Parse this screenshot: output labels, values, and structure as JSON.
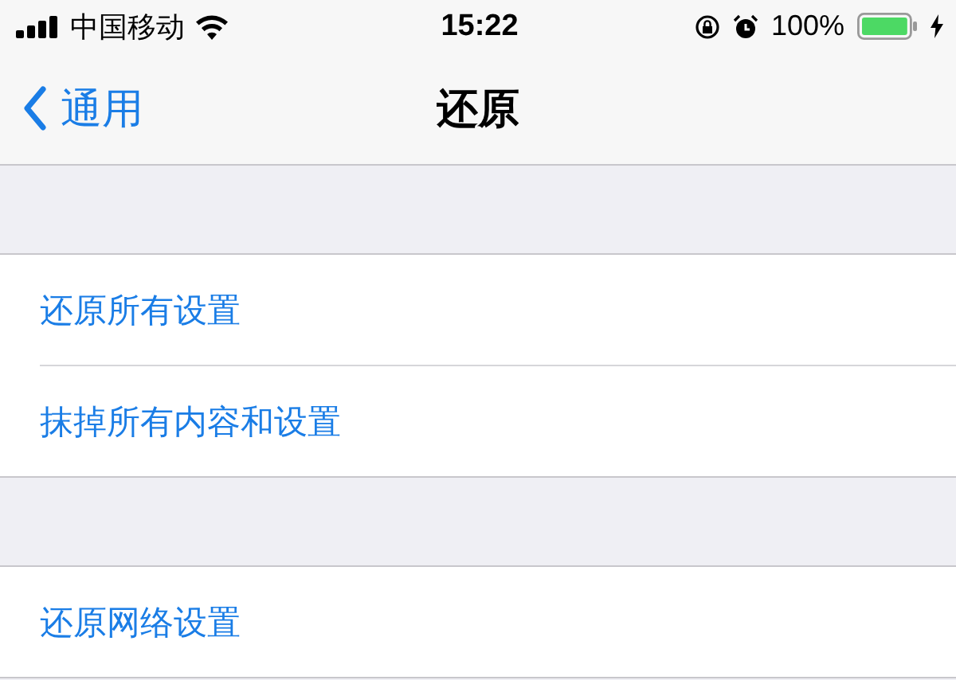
{
  "status_bar": {
    "carrier": "中国移动",
    "time": "15:22",
    "battery": "100%"
  },
  "nav_bar": {
    "back": "通用",
    "title": "还原"
  },
  "groups": [
    {
      "rows": [
        "还原所有设置",
        "抹掉所有内容和设置"
      ]
    },
    {
      "rows": [
        "还原网络设置"
      ]
    }
  ]
}
